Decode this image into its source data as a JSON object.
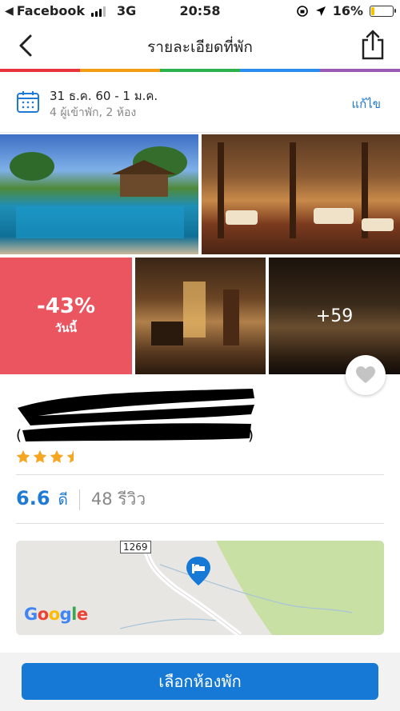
{
  "status_bar": {
    "app": "Facebook",
    "network": "3G",
    "time": "20:58",
    "battery": "16%",
    "battery_level": 0.16,
    "battery_color": "#f5c400"
  },
  "nav": {
    "title": "รายละเอียดที่พัก",
    "back_icon": "chevron-left-icon",
    "share_icon": "share-icon"
  },
  "rainbow_colors": [
    "#e8323c",
    "#f39c12",
    "#2bb24c",
    "#2d8cf0",
    "#9b59b6"
  ],
  "dates": {
    "range": "31 ธ.ค. 60 - 1 ม.ค.",
    "guests": "4 ผู้เข้าพัก, 2 ห้อง",
    "edit": "แก้ไข"
  },
  "photos": {
    "deal_percent": "-43%",
    "deal_label": "วันนี้",
    "more_count": "+59"
  },
  "hotel": {
    "stars": 3.5,
    "score": "6.6",
    "score_label": "ดี",
    "reviews": "48 รีวิว"
  },
  "map": {
    "road_number": "1269",
    "provider": "Google"
  },
  "cta": {
    "label": "เลือกห้องพัก"
  },
  "colors": {
    "accent": "#1779d6",
    "deal": "#ea5560"
  }
}
